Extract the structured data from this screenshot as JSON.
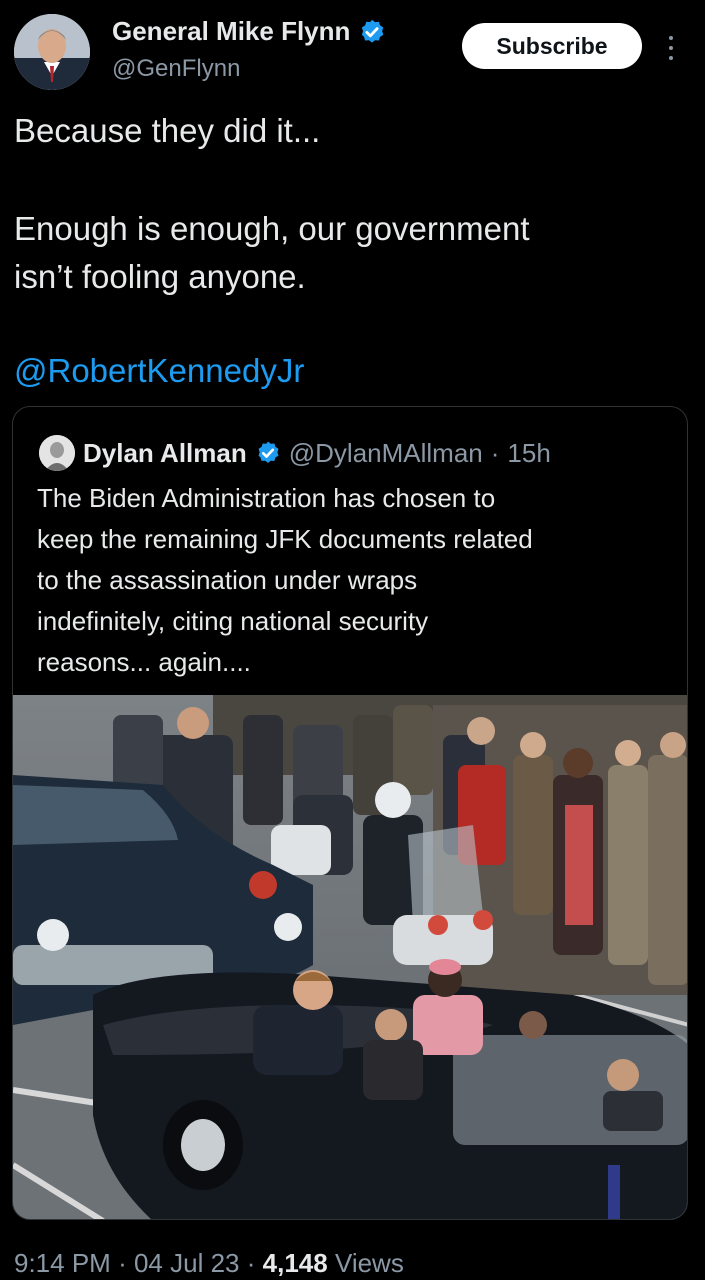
{
  "author": {
    "name": "General Mike Flynn",
    "handle": "@GenFlynn",
    "avatar_icon": "profile-photo",
    "verified_icon": "verified-badge-icon"
  },
  "actions": {
    "subscribe_label": "Subscribe",
    "more_icon": "more-vertical-icon"
  },
  "tweet": {
    "lines": [
      "Because they did it...",
      "Enough is enough, our government",
      "isn’t fooling anyone.",
      "@RobertKennedyJr"
    ]
  },
  "quote": {
    "name": "Dylan Allman",
    "handle": "@DylanMAllman",
    "separator": "·",
    "age": "15h",
    "lines": [
      "The Biden Administration has chosen to",
      "keep the remaining JFK documents related",
      "to the assassination under wraps",
      "indefinitely, citing national security",
      "reasons... again...."
    ],
    "image_icon": "motorcade-photo"
  },
  "footer": {
    "time": "9:14 PM",
    "sep1": "·",
    "date": "04 Jul 23",
    "sep2": "·",
    "views_count": "4,148",
    "views_label": "Views"
  },
  "colors": {
    "background": "#000000",
    "text": "#e7e9ea",
    "secondary": "#8b98a5",
    "accent": "#1d9bf0"
  }
}
